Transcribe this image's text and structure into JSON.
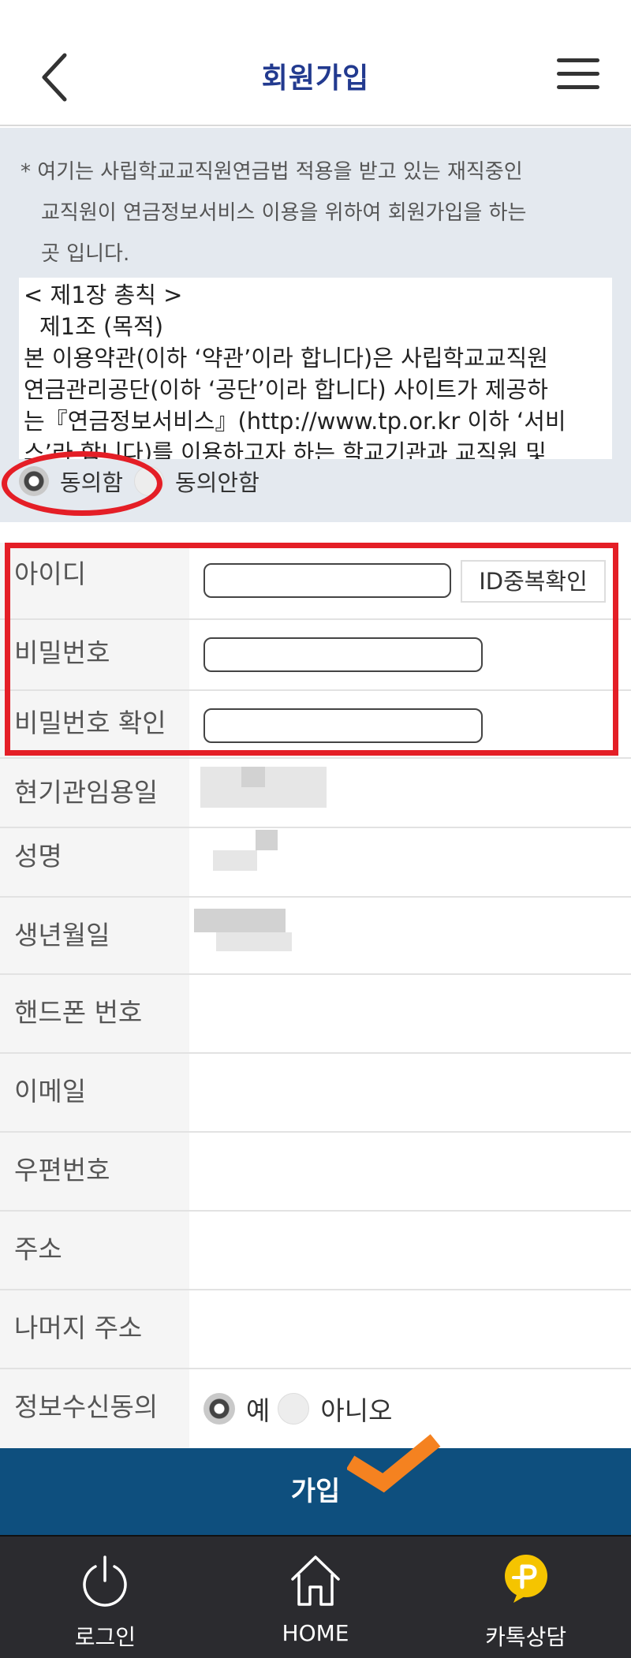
{
  "header": {
    "title": "회원가입"
  },
  "terms": {
    "notice_line1": "* 여기는 사립학교교직원연금법 적용을 받고 있는 재직중인",
    "notice_line2": "교직원이 연금정보서비스 이용을 위하여 회원가입을 하는",
    "notice_line3": "곳 입니다.",
    "body": [
      "< 제1장 총칙 >",
      "제1조 (목적)",
      "본 이용약관(이하 ‘약관’이라 합니다)은 사립학교교직원",
      "연금관리공단(이하 ‘공단’이라 합니다) 사이트가 제공하",
      "는『연금정보서비스』(http://www.tp.or.kr 이하 ‘서비",
      "스’라 합니다)를 이용하고자 하는 학교기관과 교직원 및"
    ],
    "agree_label": "동의함",
    "disagree_label": "동의안함",
    "agree_selected": "agree"
  },
  "form": {
    "id_label": "아이디",
    "id_value": "",
    "dup_check_label": "ID중복확인",
    "password_label": "비밀번호",
    "password_value": "",
    "password_confirm_label": "비밀번호 확인",
    "password_confirm_value": "",
    "hire_date_label": "현기관임용일",
    "name_label": "성명",
    "birth_label": "생년월일",
    "phone_label": "핸드폰 번호",
    "email_label": "이메일",
    "zip_label": "우편번호",
    "address_label": "주소",
    "address_rest_label": "나머지 주소",
    "info_consent_label": "정보수신동의",
    "info_yes_label": "예",
    "info_no_label": "아니오",
    "info_selected": "yes"
  },
  "join_button": {
    "label": "가입"
  },
  "bottom_nav": {
    "items": [
      {
        "label": "로그인",
        "icon": "power-icon"
      },
      {
        "label": "HOME",
        "icon": "home-icon"
      },
      {
        "label": "카톡상담",
        "icon": "kakao-plus-icon"
      }
    ]
  },
  "colors": {
    "title": "#223a8f",
    "highlight": "#e41e26",
    "join_button": "#0e4f7e",
    "nav_bg": "#2b2b2f",
    "checkmark": "#f58220",
    "kakao": "#f5c400"
  }
}
